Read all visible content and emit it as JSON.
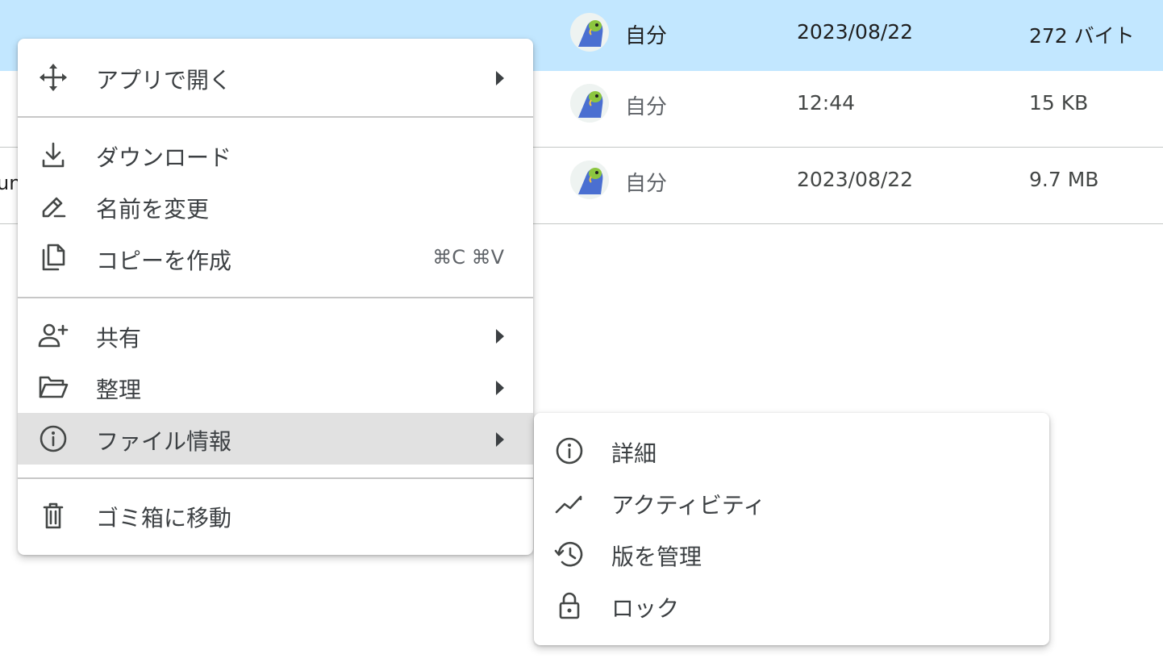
{
  "files": [
    {
      "name": "",
      "owner": "自分",
      "modified": "2023/08/22",
      "size": "272 バイト",
      "selected": true
    },
    {
      "name": "",
      "owner": "自分",
      "modified": "12:44",
      "size": "15 KB",
      "selected": false
    },
    {
      "name": "un",
      "owner": "自分",
      "modified": "2023/08/22",
      "size": "9.7 MB",
      "selected": false
    }
  ],
  "context_menu": {
    "open_with": {
      "label": "アプリで開く",
      "icon": "move-icon"
    },
    "download": {
      "label": "ダウンロード",
      "icon": "download-icon"
    },
    "rename": {
      "label": "名前を変更",
      "icon": "rename-pen-icon"
    },
    "make_copy": {
      "label": "コピーを作成",
      "shortcut": "⌘C ⌘V",
      "icon": "copy-icon"
    },
    "share": {
      "label": "共有",
      "icon": "person-add-icon"
    },
    "organize": {
      "label": "整理",
      "icon": "folder-open-icon"
    },
    "file_info": {
      "label": "ファイル情報",
      "icon": "info-icon"
    },
    "trash": {
      "label": "ゴミ箱に移動",
      "icon": "trash-icon"
    }
  },
  "file_info_submenu": {
    "details": {
      "label": "詳細",
      "icon": "info-icon"
    },
    "activity": {
      "label": "アクティビティ",
      "icon": "activity-icon"
    },
    "manage_versions": {
      "label": "版を管理",
      "icon": "history-icon"
    },
    "lock": {
      "label": "ロック",
      "icon": "lock-icon"
    }
  },
  "colors": {
    "selected_row": "#c2e7ff",
    "highlight": "#e1e1e1",
    "text": "#3c4043"
  }
}
